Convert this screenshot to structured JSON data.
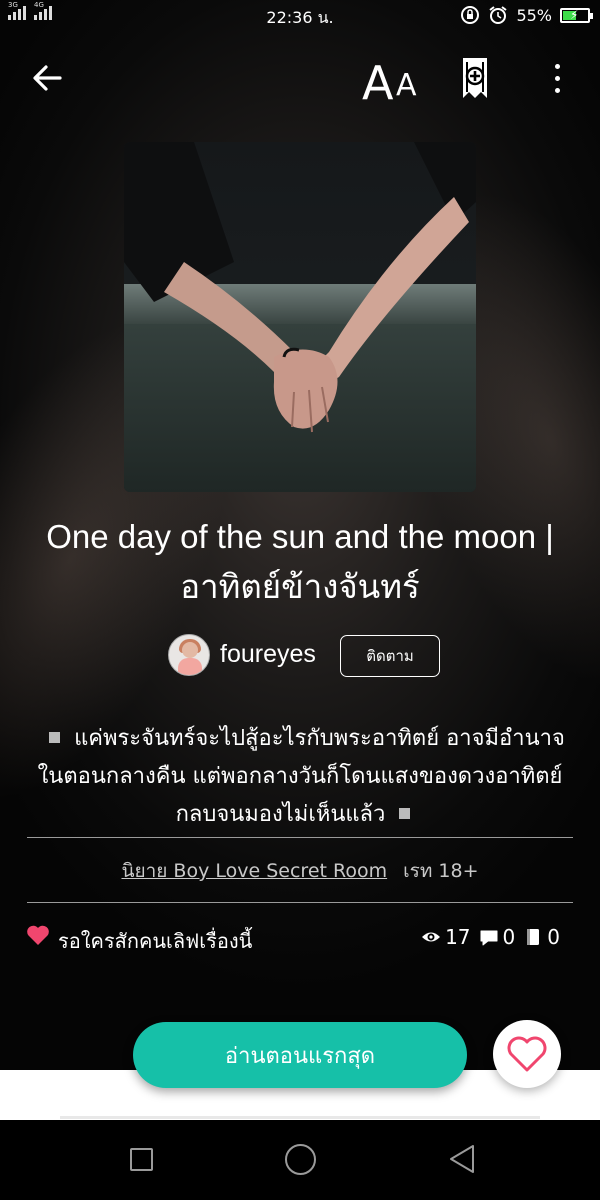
{
  "status_bar": {
    "signal1_label": "3G",
    "signal2_label": "4G",
    "time": "22:36 น.",
    "battery_percent_text": "55%",
    "battery_level": 0.55
  },
  "toolbar": {
    "back_icon": "arrow-left-icon",
    "font_size_icon": "font-size-icon",
    "font_icon_big": "A",
    "font_icon_small": "A",
    "add_library_icon": "add-to-library-icon",
    "more_icon": "more-vertical-icon"
  },
  "novel": {
    "title": "One day of the sun and the moon | อาทิตย์ข้างจันทร์",
    "author": "foureyes",
    "follow_label": "ติดตาม",
    "synopsis": "แค่พระจันทร์จะไปสู้อะไรกับพระอาทิตย์ อาจมีอำนาจในตอนกลางคืน แต่พอกลางวันก็โดนแสงของดวงอาทิตย์กลบจนมองไม่เห็นแล้ว",
    "category": "นิยาย Boy Love Secret Room",
    "rating": "เรท 18+",
    "wait_text": "รอใครสักคนเลิฟเรื่องนี้",
    "stats": {
      "views": "17",
      "comments": "0",
      "chapters": "0"
    }
  },
  "actions": {
    "read_first_label": "อ่านตอนแรกสุด",
    "favorite_icon": "heart-outline-icon"
  },
  "colors": {
    "accent": "#16c0a8",
    "heart": "#f0466e",
    "battery": "#3ddc4a"
  }
}
